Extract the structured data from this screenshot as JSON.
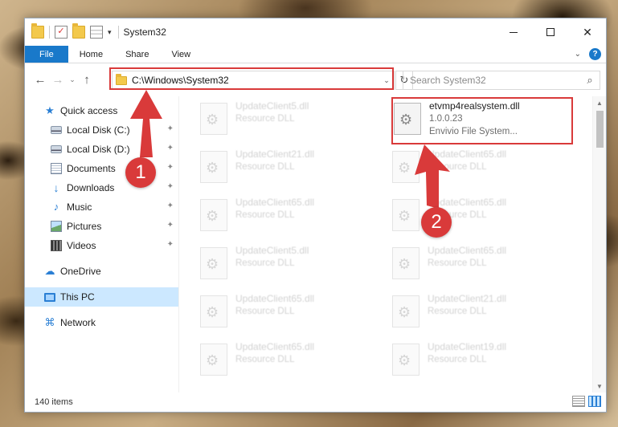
{
  "window": {
    "title": "System32"
  },
  "titlebar": {
    "quick_access_dropdown": "▾",
    "minimize": "minimize",
    "maximize": "maximize",
    "close": "✕"
  },
  "ribbon": {
    "tabs": [
      "File",
      "Home",
      "Share",
      "View"
    ],
    "collapse_glyph": "⌄",
    "help_glyph": "?"
  },
  "navbar": {
    "back": "←",
    "forward": "→",
    "recent": "⌄",
    "up": "↑",
    "address": "C:\\Windows\\System32",
    "address_dropdown": "⌄",
    "refresh": "↻",
    "search_placeholder": "Search System32",
    "search_icon": "⌕"
  },
  "sidebar": {
    "items": [
      {
        "label": "Quick access",
        "icon": "star-icon"
      },
      {
        "label": "Local Disk (C:)",
        "icon": "drive-icon",
        "pinned": true
      },
      {
        "label": "Local Disk (D:)",
        "icon": "drive-icon",
        "pinned": true
      },
      {
        "label": "Documents",
        "icon": "documents-icon",
        "pinned": true
      },
      {
        "label": "Downloads",
        "icon": "download-icon",
        "pinned": true
      },
      {
        "label": "Music",
        "icon": "music-icon",
        "pinned": true
      },
      {
        "label": "Pictures",
        "icon": "pictures-icon",
        "pinned": true
      },
      {
        "label": "Videos",
        "icon": "videos-icon",
        "pinned": true
      },
      {
        "label": "OneDrive",
        "icon": "cloud-icon"
      },
      {
        "label": "This PC",
        "icon": "computer-icon",
        "selected": true
      },
      {
        "label": "Network",
        "icon": "network-icon"
      }
    ],
    "pin_glyph": "📌"
  },
  "files": {
    "left_column": [
      {
        "name": "UpdateClient5.dll",
        "meta": "Resource DLL"
      },
      {
        "name": "UpdateClient21.dll",
        "meta": "Resource DLL"
      },
      {
        "name": "UpdateClient65.dll",
        "meta": "Resource DLL"
      },
      {
        "name": "UpdateClient5.dll",
        "meta": "Resource DLL"
      },
      {
        "name": "UpdateClient65.dll",
        "meta": "Resource DLL"
      },
      {
        "name": "UpdateClient65.dll",
        "meta": "Resource DLL"
      }
    ],
    "right_column": [
      {
        "name": "UpdateClient65.dll",
        "meta": "Resource DLL"
      },
      {
        "name": "UpdateClient65.dll",
        "meta": "Resource DLL"
      },
      {
        "name": "UpdateClient65.dll",
        "meta": "Resource DLL"
      },
      {
        "name": "UpdateClient21.dll",
        "meta": "Resource DLL"
      },
      {
        "name": "UpdateClient19.dll",
        "meta": "Resource DLL"
      }
    ],
    "highlighted": {
      "name": "etvmp4realsystem.dll",
      "version": "1.0.0.23",
      "description": "Envivio File System..."
    }
  },
  "scrollbar": {
    "up": "▲",
    "down": "▼"
  },
  "status": {
    "item_count": "140 items"
  },
  "annotations": {
    "badge_1": "1",
    "badge_2": "2",
    "accent_color": "#d93a3a"
  }
}
